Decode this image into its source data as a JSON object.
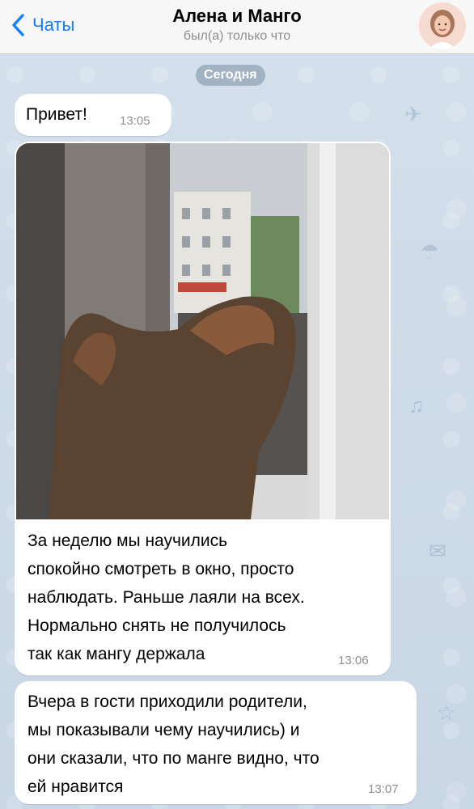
{
  "header": {
    "back_label": "Чаты",
    "title": "Алена и Манго",
    "status": "был(а) только что"
  },
  "date_separator": "Сегодня",
  "messages": [
    {
      "text": "Привет!",
      "time": "13:05"
    },
    {
      "lines": [
        "За неделю мы научились",
        "спокойно смотреть в окно, просто",
        "наблюдать. Раньше лаяли на всех.",
        "Нормально снять не получилось",
        "так как мангу держала"
      ],
      "time": "13:06"
    },
    {
      "lines": [
        "Вчера в гости приходили родители,",
        "мы показывали чему научились) и",
        "они сказали, что по манге видно, что",
        "ей нравится"
      ],
      "time": "13:07"
    }
  ],
  "colors": {
    "accent": "#147efb",
    "bubble": "#ffffff",
    "chat_bg": "#cfdbe8"
  }
}
